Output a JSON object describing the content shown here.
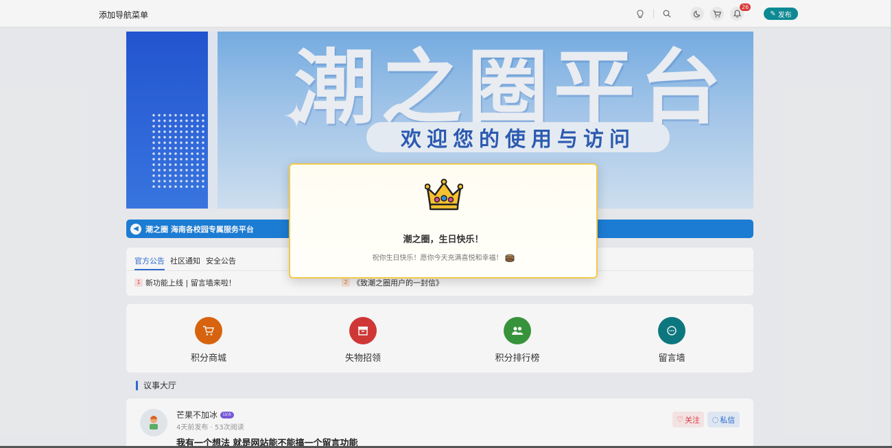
{
  "header": {
    "nav_label": "添加导航菜单",
    "notification_count": "26",
    "publish_label": "发布"
  },
  "banner": {
    "title": "潮之圈平台",
    "subtitle": "欢迎您的使用与访问"
  },
  "notice_bar": {
    "text": "潮之圈 海南各校园专属服务平台"
  },
  "announcements": {
    "tabs": [
      {
        "label": "官方公告",
        "active": true
      },
      {
        "label": "社区通知",
        "active": false
      },
      {
        "label": "安全公告",
        "active": false
      }
    ],
    "items": [
      {
        "num": "1",
        "text": "新功能上线 | 留言墙来啦！"
      },
      {
        "num": "2",
        "text": "《致潮之圈用户的一封信》"
      }
    ]
  },
  "quick_entries": [
    {
      "label": "积分商城",
      "icon": "cart-icon",
      "color": "#e0680f"
    },
    {
      "label": "失物招领",
      "icon": "box-icon",
      "color": "#d83a3a"
    },
    {
      "label": "积分排行榜",
      "icon": "users-icon",
      "color": "#3a9a3e"
    },
    {
      "label": "留言墙",
      "icon": "chat-icon",
      "color": "#0e7c86"
    }
  ],
  "section": {
    "title": "议事大厅"
  },
  "post": {
    "username": "芒果不加冰",
    "level": "LV.6",
    "meta": "4天前发布 · 53次阅读",
    "title": "我有一个想法 就是网站能不能搞一个留言功能",
    "follow_label": "关注",
    "message_label": "私信"
  },
  "modal": {
    "title": "潮之圈，生日快乐！",
    "subtitle": "祝你生日快乐！愿你今天充满喜悦和幸福！"
  },
  "colors": {
    "accent": "#2f6fd6",
    "publish": "#0e8f9a",
    "notice": "#1e82dc",
    "modal_border": "#f3c94a"
  }
}
